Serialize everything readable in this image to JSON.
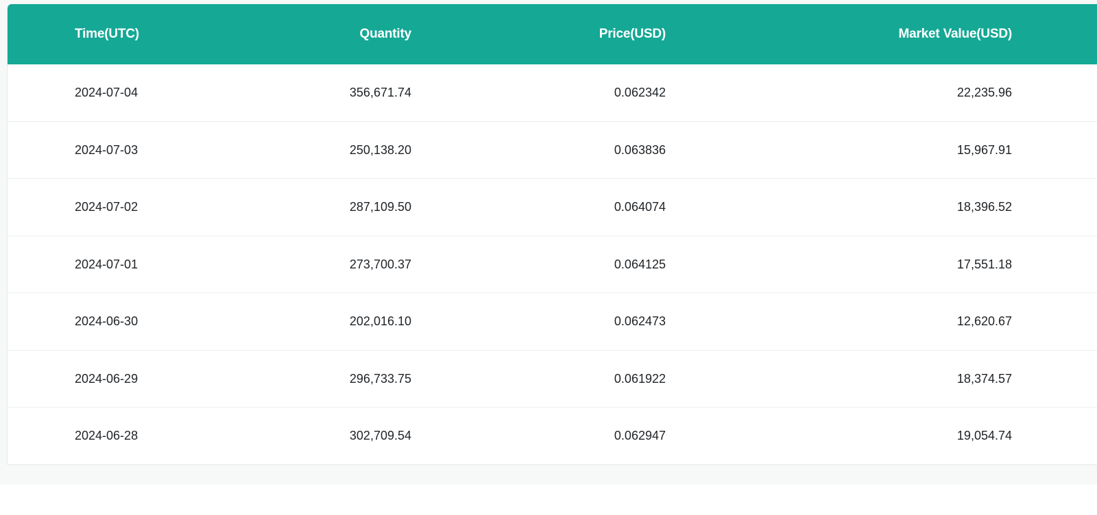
{
  "table": {
    "columns": [
      "Time(UTC)",
      "Quantity",
      "Price(USD)",
      "Market Value(USD)"
    ],
    "rows": [
      {
        "time": "2024-07-04",
        "quantity": "356,671.74",
        "price": "0.062342",
        "market_value": "22,235.96"
      },
      {
        "time": "2024-07-03",
        "quantity": "250,138.20",
        "price": "0.063836",
        "market_value": "15,967.91"
      },
      {
        "time": "2024-07-02",
        "quantity": "287,109.50",
        "price": "0.064074",
        "market_value": "18,396.52"
      },
      {
        "time": "2024-07-01",
        "quantity": "273,700.37",
        "price": "0.064125",
        "market_value": "17,551.18"
      },
      {
        "time": "2024-06-30",
        "quantity": "202,016.10",
        "price": "0.062473",
        "market_value": "12,620.67"
      },
      {
        "time": "2024-06-29",
        "quantity": "296,733.75",
        "price": "0.061922",
        "market_value": "18,374.57"
      },
      {
        "time": "2024-06-28",
        "quantity": "302,709.54",
        "price": "0.062947",
        "market_value": "19,054.74"
      }
    ]
  },
  "colors": {
    "header_bg": "#14a895",
    "header_text": "#ffffff",
    "row_text": "#1e2226",
    "row_border": "#eceeef"
  }
}
